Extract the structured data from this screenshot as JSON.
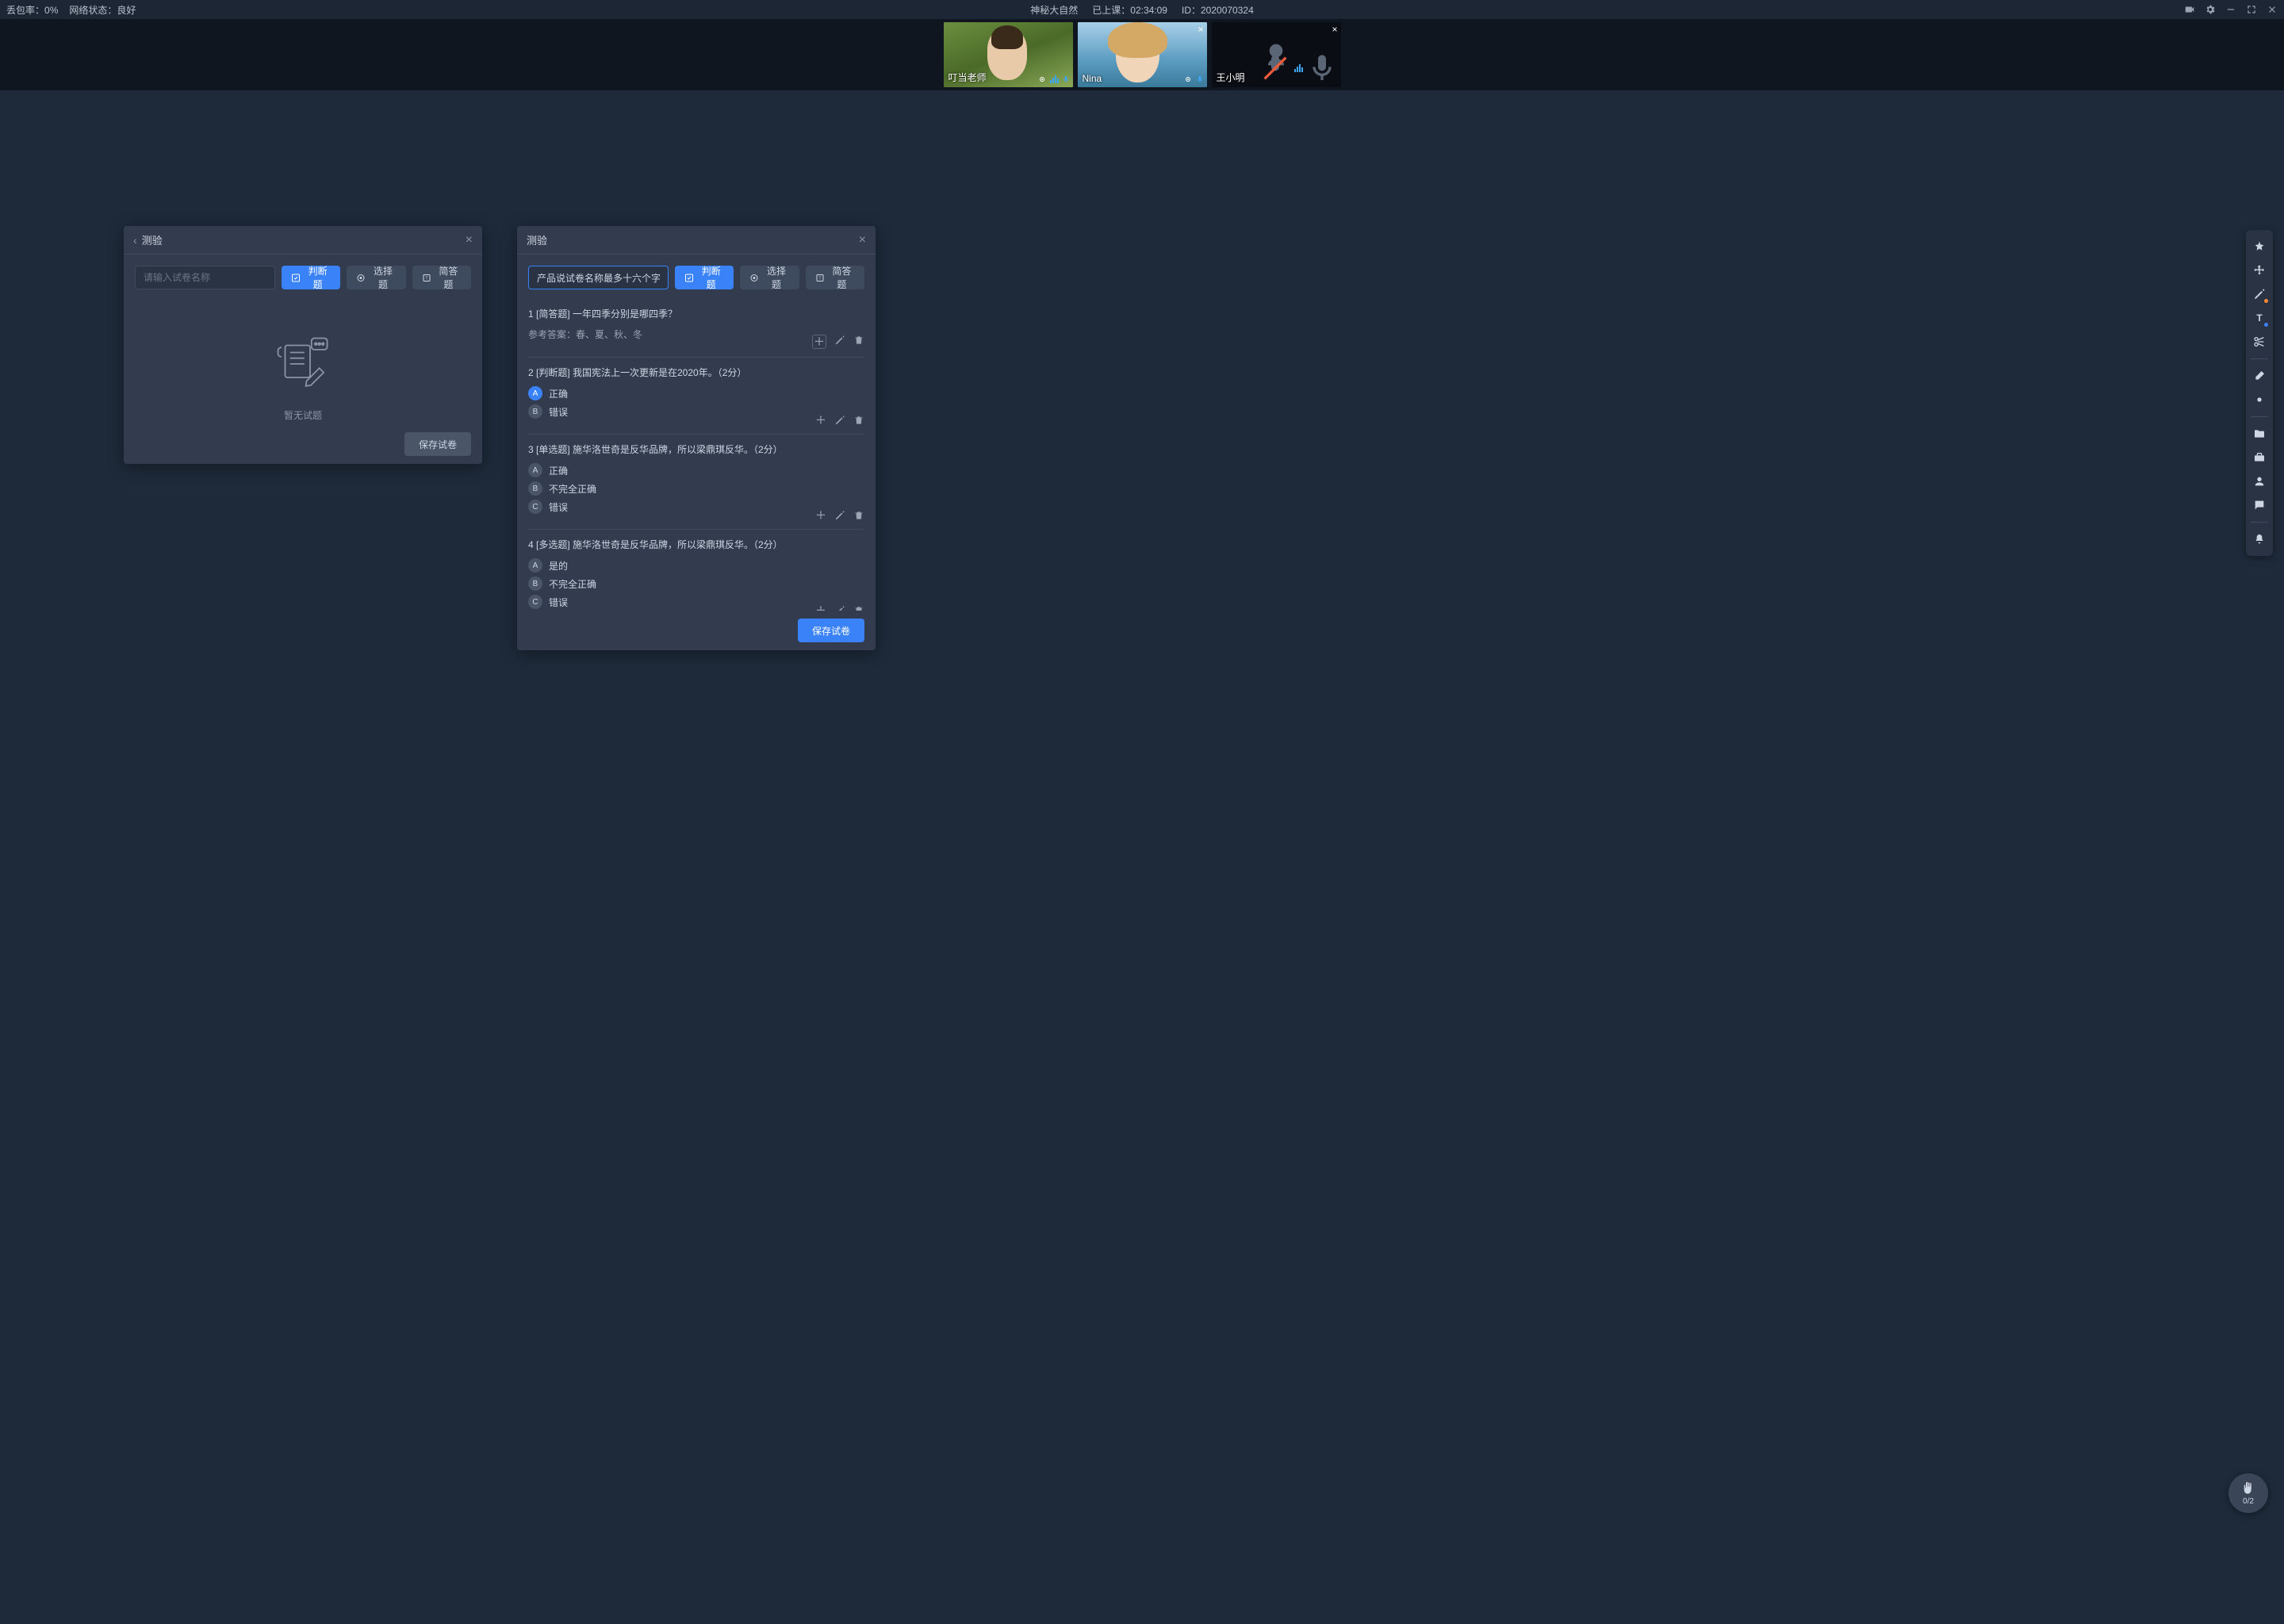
{
  "header": {
    "packet_loss_label": "丢包率：",
    "packet_loss_value": "0%",
    "network_label": "网络状态：",
    "network_value": "良好",
    "course_name": "神秘大自然",
    "duration_label": "已上课：",
    "duration_value": "02:34:09",
    "id_label": "ID：",
    "id_value": "2020070324"
  },
  "videos": [
    {
      "name": "叮当老师",
      "camera": true,
      "closable": false
    },
    {
      "name": "Nina",
      "camera": true,
      "closable": true
    },
    {
      "name": "王小明",
      "camera": false,
      "closable": true
    }
  ],
  "panel_left": {
    "title": "测验",
    "input_placeholder": "请输入试卷名称",
    "btn_judge": "判断题",
    "btn_choice": "选择题",
    "btn_short": "简答题",
    "empty_text": "暂无试题",
    "save_btn": "保存试卷"
  },
  "panel_right": {
    "title": "测验",
    "input_value": "产品说试卷名称最多十六个字",
    "btn_judge": "判断题",
    "btn_choice": "选择题",
    "btn_short": "简答题",
    "save_btn": "保存试卷",
    "questions": [
      {
        "num": "1",
        "tag": "[简答题]",
        "text": "一年四季分别是哪四季？",
        "ref_answer_label": "参考答案：",
        "ref_answer": "春、夏、秋、冬",
        "options": []
      },
      {
        "num": "2",
        "tag": "[判断题]",
        "text": "我国宪法上一次更新是在2020年。（2分）",
        "options": [
          {
            "letter": "A",
            "label": "正确",
            "selected": true
          },
          {
            "letter": "B",
            "label": "错误",
            "selected": false
          }
        ]
      },
      {
        "num": "3",
        "tag": "[单选题]",
        "text": "施华洛世奇是反华品牌，所以梁鼎琪反华。（2分）",
        "options": [
          {
            "letter": "A",
            "label": "正确",
            "selected": false
          },
          {
            "letter": "B",
            "label": "不完全正确",
            "selected": false
          },
          {
            "letter": "C",
            "label": "错误",
            "selected": false
          }
        ]
      },
      {
        "num": "4",
        "tag": "[多选题]",
        "text": "施华洛世奇是反华品牌，所以梁鼎琪反华。（2分）",
        "options": [
          {
            "letter": "A",
            "label": "是的",
            "selected": false
          },
          {
            "letter": "B",
            "label": "不完全正确",
            "selected": false
          },
          {
            "letter": "C",
            "label": "错误",
            "selected": false
          }
        ]
      }
    ]
  },
  "hand": {
    "count": "0/2"
  }
}
